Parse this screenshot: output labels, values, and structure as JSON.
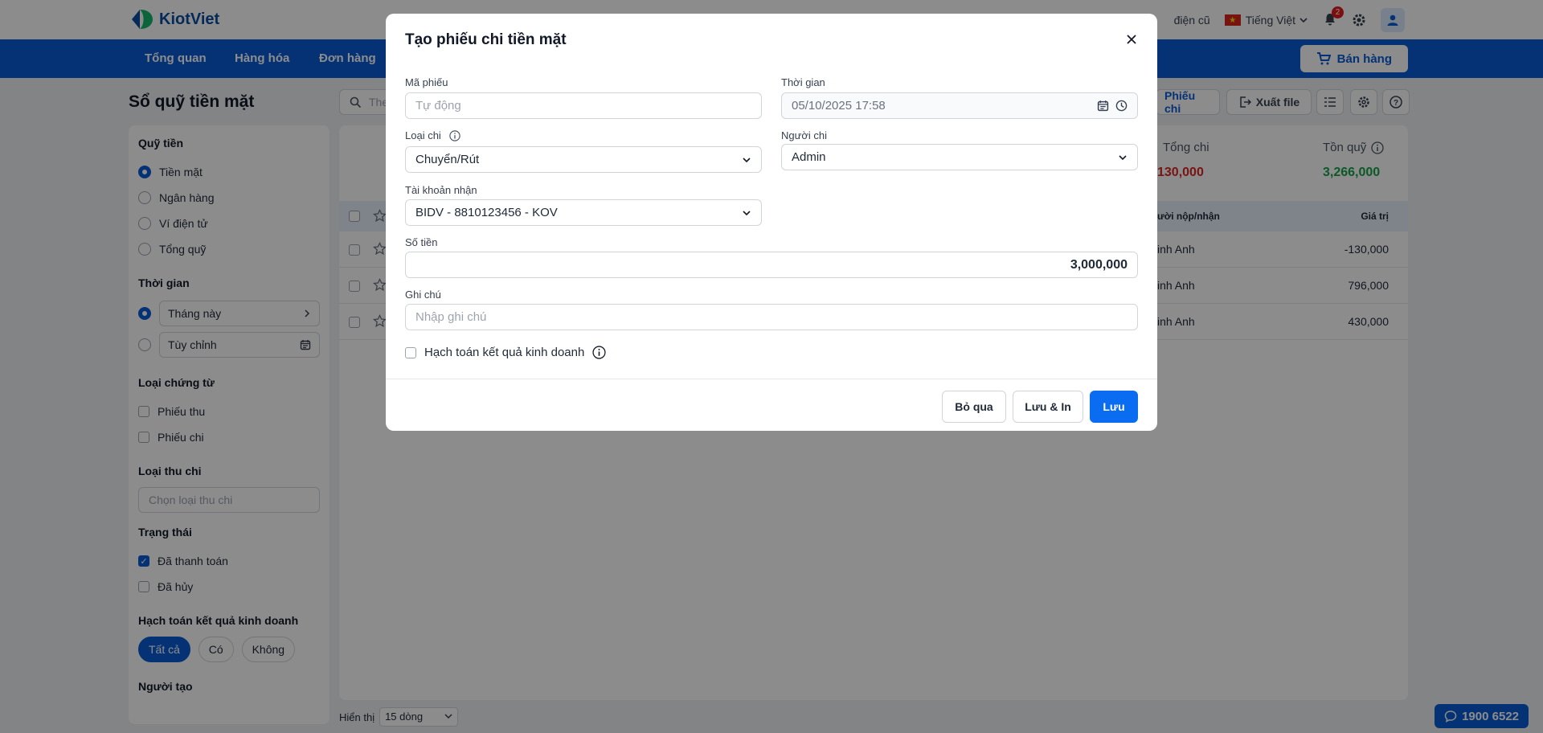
{
  "header": {
    "logo_text": "KiotViet",
    "old_ui_link": "điện cũ",
    "language": "Tiếng Việt",
    "notification_count": "2"
  },
  "nav": {
    "items": [
      "Tổng quan",
      "Hàng hóa",
      "Đơn hàng"
    ],
    "sell_button": "Bán hàng"
  },
  "page": {
    "title": "Sổ quỹ tiền mặt",
    "search_placeholder": "The",
    "btn_phieu_chi": "Phiếu chi",
    "btn_export": "Xuất file"
  },
  "sidebar": {
    "fund": {
      "title": "Quỹ tiền",
      "options": [
        "Tiền mặt",
        "Ngân hàng",
        "Ví điện tử",
        "Tổng quỹ"
      ]
    },
    "time": {
      "title": "Thời gian",
      "this_month": "Tháng này",
      "custom": "Tùy chỉnh"
    },
    "doc_type": {
      "title": "Loại chứng từ",
      "options": [
        "Phiếu thu",
        "Phiếu chi"
      ]
    },
    "category": {
      "title": "Loại thu chi",
      "placeholder": "Chọn loại thu chi"
    },
    "status": {
      "title": "Trạng thái",
      "options": [
        "Đã thanh toán",
        "Đã hủy"
      ]
    },
    "accounting": {
      "title": "Hạch toán kết quả kinh doanh",
      "pills": [
        "Tất cả",
        "Có",
        "Không"
      ]
    },
    "creator": {
      "title": "Người tạo"
    }
  },
  "summary": {
    "total_out_label": "Tổng chi",
    "total_out_value": "130,000",
    "balance_label": "Tồn quỹ",
    "balance_value": "3,266,000"
  },
  "table": {
    "headers": {
      "person": "ười nộp/nhận",
      "value": "Giá trị"
    },
    "rows": [
      {
        "person": "inh Anh",
        "value": "-130,000"
      },
      {
        "person": "inh Anh",
        "value": "796,000"
      },
      {
        "person": "inh Anh",
        "value": "430,000"
      }
    ]
  },
  "pager": {
    "label": "Hiển thị",
    "page_size": "15 dòng"
  },
  "hotline": "1900 6522",
  "modal": {
    "title": "Tạo phiếu chi tiền mặt",
    "code_label": "Mã phiếu",
    "code_placeholder": "Tự động",
    "time_label": "Thời gian",
    "time_value": "05/10/2025 17:58",
    "type_label": "Loại chi",
    "type_value": "Chuyển/Rút",
    "payer_label": "Người chi",
    "payer_value": "Admin",
    "account_label": "Tài khoản nhận",
    "account_value": "BIDV - 8810123456 - KOV",
    "amount_label": "Số tiền",
    "amount_value": "3,000,000",
    "note_label": "Ghi chú",
    "note_placeholder": "Nhập ghi chú",
    "accounting_label": "Hạch toán kết quả kinh doanh",
    "btn_skip": "Bỏ qua",
    "btn_save_print": "Lưu & In",
    "btn_save": "Lưu"
  },
  "colors": {
    "brand": "#0a5cd6",
    "negative": "#dc2626",
    "positive": "#16a34a",
    "primary_button": "#0a6cf0"
  }
}
